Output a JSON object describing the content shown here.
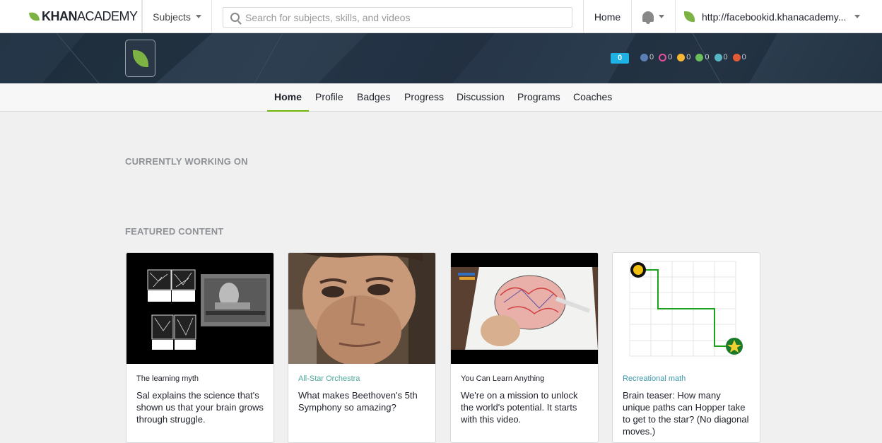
{
  "topbar": {
    "logo_bold": "KHAN",
    "logo_light": "ACADEMY",
    "subjects_label": "Subjects",
    "search_placeholder": "Search for subjects, skills, and videos",
    "home_label": "Home",
    "user_label": "http://facebookid.khanacademy..."
  },
  "banner": {
    "points": "0",
    "badges": [
      {
        "icon": "meteorite-badge-icon",
        "color": "#5b7fb4",
        "count": "0"
      },
      {
        "icon": "moon-badge-icon",
        "color": "#e84fa0",
        "count": "0"
      },
      {
        "icon": "earth-badge-icon",
        "color": "#f5b731",
        "count": "0"
      },
      {
        "icon": "sun-badge-icon",
        "color": "#6bbf5a",
        "count": "0"
      },
      {
        "icon": "black-hole-badge-icon",
        "color": "#58b6c4",
        "count": "0"
      },
      {
        "icon": "challenge-patch-icon",
        "color": "#e55a36",
        "count": "0"
      }
    ]
  },
  "tabs": [
    "Home",
    "Profile",
    "Badges",
    "Progress",
    "Discussion",
    "Programs",
    "Coaches"
  ],
  "sections": {
    "working_on": "CURRENTLY WORKING ON",
    "featured": "FEATURED CONTENT"
  },
  "cards": [
    {
      "label": "The learning myth",
      "label_color": "#21242c",
      "desc": "Sal explains the science that's shown us that your brain grows through struggle."
    },
    {
      "label": "All-Star Orchestra",
      "label_color": "#4aa99a",
      "desc": "What makes Beethoven's 5th Symphony so amazing?"
    },
    {
      "label": "You Can Learn Anything",
      "label_color": "#21242c",
      "desc": "We're on a mission to unlock the world's potential. It starts with this video."
    },
    {
      "label": "Recreational math",
      "label_color": "#3a97a8",
      "desc": "Brain teaser: How many unique paths can Hopper take to get to the star? (No diagonal moves.)"
    }
  ],
  "colors": {
    "accent_green": "#71b307",
    "points_blue": "#1eb2e4"
  }
}
